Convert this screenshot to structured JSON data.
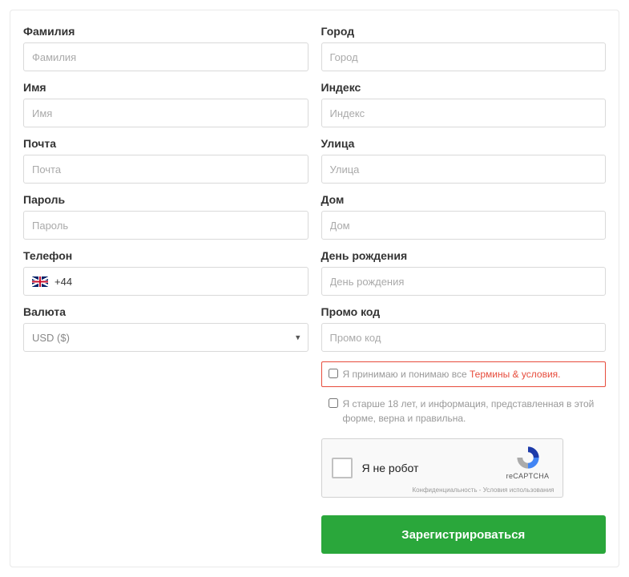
{
  "left": {
    "surname": {
      "label": "Фамилия",
      "placeholder": "Фамилия"
    },
    "firstname": {
      "label": "Имя",
      "placeholder": "Имя"
    },
    "email": {
      "label": "Почта",
      "placeholder": "Почта"
    },
    "password": {
      "label": "Пароль",
      "placeholder": "Пароль"
    },
    "phone": {
      "label": "Телефон",
      "dial_code": "+44"
    },
    "currency": {
      "label": "Валюта",
      "value": "USD ($)"
    }
  },
  "right": {
    "city": {
      "label": "Город",
      "placeholder": "Город"
    },
    "zip": {
      "label": "Индекс",
      "placeholder": "Индекс"
    },
    "street": {
      "label": "Улица",
      "placeholder": "Улица"
    },
    "house": {
      "label": "Дом",
      "placeholder": "Дом"
    },
    "birthday": {
      "label": "День рождения",
      "placeholder": "День рождения"
    },
    "promo": {
      "label": "Промо код",
      "placeholder": "Промо код"
    }
  },
  "consent": {
    "terms_prefix": "Я принимаю и понимаю все ",
    "terms_link": "Термины & условия.",
    "age_text": "Я старше 18 лет, и информация, представленная в этой форме, верна и правильна."
  },
  "recaptcha": {
    "label": "Я не робот",
    "brand": "reCAPTCHA",
    "legal": "Конфиденциальность - Условия использования"
  },
  "submit_label": "Зарегистрироваться",
  "colors": {
    "accent_green": "#2aa73b",
    "error_red": "#e74c3c"
  }
}
